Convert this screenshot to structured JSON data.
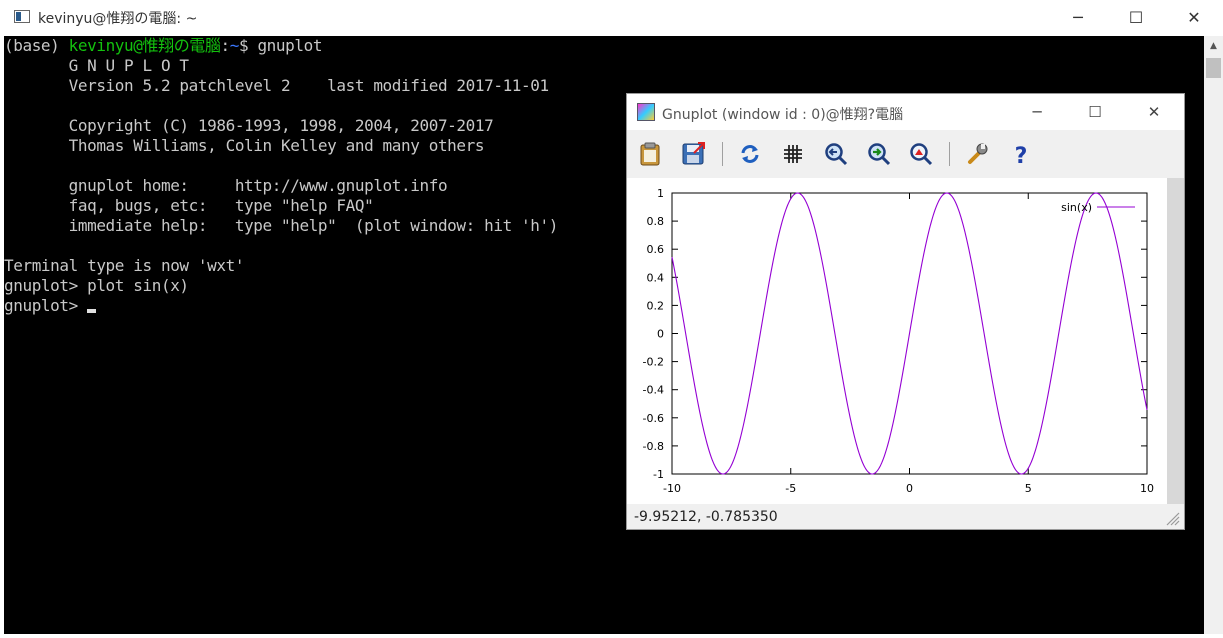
{
  "terminal": {
    "title": "kevinyu@惟翔の電腦: ~",
    "prompt_env": "(base) ",
    "prompt_user": "kevinyu@惟翔の電腦",
    "prompt_colon": ":",
    "prompt_dir": "~",
    "prompt_cmd": "$ gnuplot",
    "banner": "\n       G N U P L O T\n       Version 5.2 patchlevel 2    last modified 2017-11-01\n\n       Copyright (C) 1986-1993, 1998, 2004, 2007-2017\n       Thomas Williams, Colin Kelley and many others\n\n       gnuplot home:     http://www.gnuplot.info\n       faq, bugs, etc:   type \"help FAQ\"\n       immediate help:   type \"help\"  (plot window: hit 'h')\n\nTerminal type is now 'wxt'\ngnuplot> plot sin(x)\ngnuplot> ",
    "min_glyph": "─",
    "max_glyph": "☐",
    "close_glyph": "✕"
  },
  "gnuplot_window": {
    "title": "Gnuplot (window id : 0)@惟翔?電腦",
    "min_glyph": "─",
    "max_glyph": "☐",
    "close_glyph": "✕",
    "toolbar": [
      {
        "name": "copy-clipboard-icon"
      },
      {
        "name": "export-icon"
      },
      {
        "name": "replot-icon"
      },
      {
        "name": "grid-icon"
      },
      {
        "name": "zoom-previous-icon"
      },
      {
        "name": "zoom-next-icon"
      },
      {
        "name": "autoscale-icon"
      },
      {
        "name": "config-wrench-icon"
      },
      {
        "name": "help-icon"
      }
    ],
    "status_coords": "-9.95212, -0.785350",
    "colors": {
      "series": "#9400d3",
      "border": "#000000"
    }
  },
  "chart_data": {
    "type": "line",
    "function": "sin(x)",
    "xlim": [
      -10,
      10
    ],
    "ylim": [
      -1,
      1
    ],
    "xticks": [
      -10,
      -5,
      0,
      5,
      10
    ],
    "yticks": [
      1,
      0.8,
      0.6,
      0.4,
      0.2,
      0,
      -0.2,
      -0.4,
      -0.6,
      -0.8,
      -1
    ],
    "series": [
      {
        "name": "sin(x)",
        "color": "#9400d3"
      }
    ],
    "legend": "top-right",
    "grid": false
  }
}
